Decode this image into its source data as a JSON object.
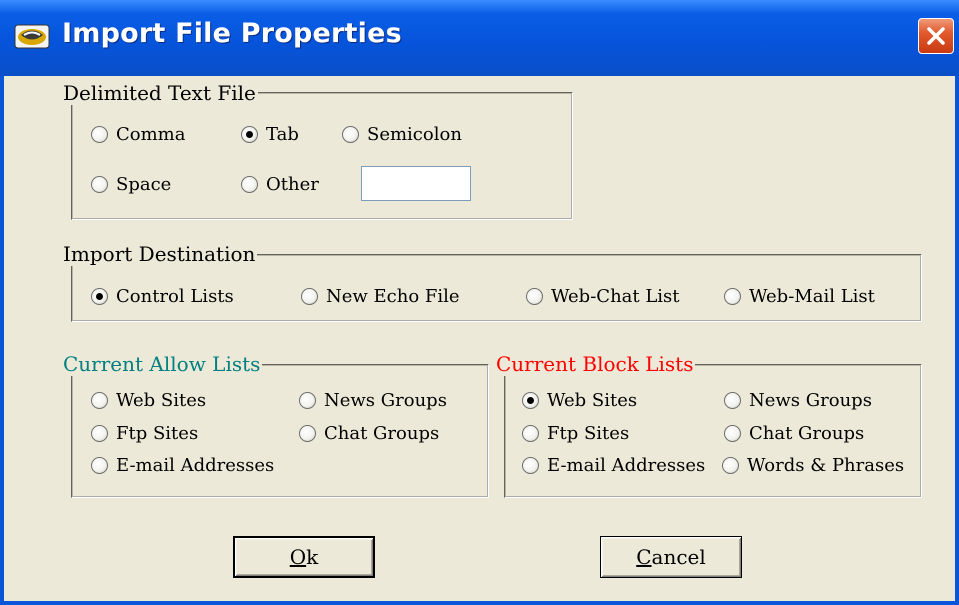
{
  "window": {
    "title": "Import File Properties",
    "app_icon": "sheriff-app-icon",
    "close_icon": "close-x-icon"
  },
  "delimited": {
    "label": "Delimited Text File",
    "options": [
      {
        "label": "Comma",
        "checked": false
      },
      {
        "label": "Tab",
        "checked": true
      },
      {
        "label": "Semicolon",
        "checked": false
      },
      {
        "label": "Space",
        "checked": false
      },
      {
        "label": "Other",
        "checked": false
      }
    ],
    "other_value": ""
  },
  "destination": {
    "label": "Import Destination",
    "options": [
      {
        "label": "Control Lists",
        "checked": true
      },
      {
        "label": "New Echo File",
        "checked": false
      },
      {
        "label": "Web-Chat List",
        "checked": false
      },
      {
        "label": "Web-Mail List",
        "checked": false
      }
    ]
  },
  "allow": {
    "label": "Current Allow Lists",
    "label_color": "#008080",
    "options": [
      {
        "label": "Web Sites",
        "checked": false
      },
      {
        "label": "News Groups",
        "checked": false
      },
      {
        "label": "Ftp Sites",
        "checked": false
      },
      {
        "label": "Chat Groups",
        "checked": false
      },
      {
        "label": "E-mail Addresses",
        "checked": false
      }
    ]
  },
  "block": {
    "label": "Current Block Lists",
    "label_color": "#ff0000",
    "options": [
      {
        "label": "Web Sites",
        "checked": true
      },
      {
        "label": "News Groups",
        "checked": false
      },
      {
        "label": "Ftp Sites",
        "checked": false
      },
      {
        "label": "Chat Groups",
        "checked": false
      },
      {
        "label": "E-mail Addresses",
        "checked": false
      },
      {
        "label": "Words & Phrases",
        "checked": false
      }
    ]
  },
  "buttons": {
    "ok_accel": "O",
    "ok_rest": "k",
    "cancel_accel": "C",
    "cancel_rest": "ancel"
  }
}
